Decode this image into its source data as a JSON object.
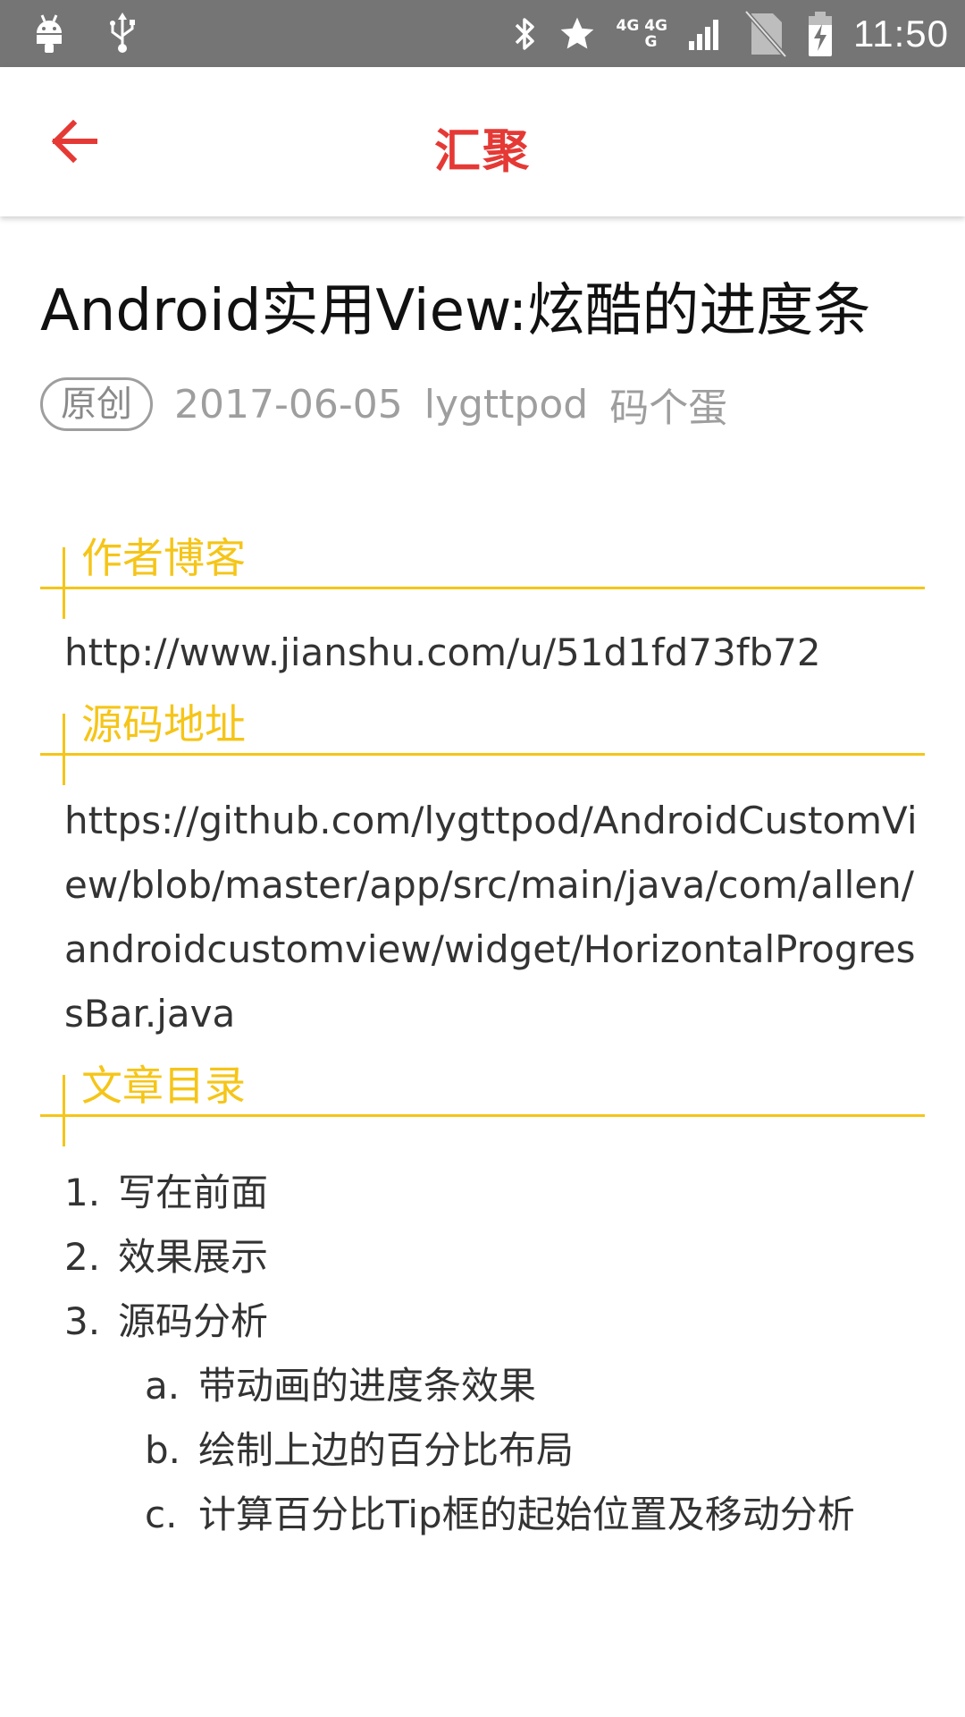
{
  "status_bar": {
    "time": "11:50",
    "network_top": "4G 4G",
    "network_bottom": "G"
  },
  "app_bar": {
    "title": "汇聚"
  },
  "article": {
    "title": "Android实用View:炫酷的进度条",
    "badge": "原创",
    "date": "2017-06-05",
    "author": "lygttpod",
    "source": "码个蛋"
  },
  "sections": {
    "blog": {
      "title": "作者博客",
      "content": "http://www.jianshu.com/u/51d1fd73fb72"
    },
    "source": {
      "title": "源码地址",
      "content": "https://github.com/lygttpod/AndroidCustomView/blob/master/app/src/main/java/com/allen/androidcustomview/widget/HorizontalProgressBar.java"
    },
    "toc": {
      "title": "文章目录",
      "items": [
        {
          "num": "1.",
          "text": "写在前面"
        },
        {
          "num": "2.",
          "text": "效果展示"
        },
        {
          "num": "3.",
          "text": "源码分析"
        }
      ],
      "sub_items": [
        {
          "num": "a.",
          "text": "带动画的进度条效果"
        },
        {
          "num": "b.",
          "text": "绘制上边的百分比布局"
        },
        {
          "num": "c.",
          "text": "计算百分比Tip框的起始位置及移动分析"
        }
      ]
    }
  },
  "colors": {
    "accent_red": "#e53935",
    "section_yellow": "#f5c518",
    "status_bar": "#757575"
  }
}
